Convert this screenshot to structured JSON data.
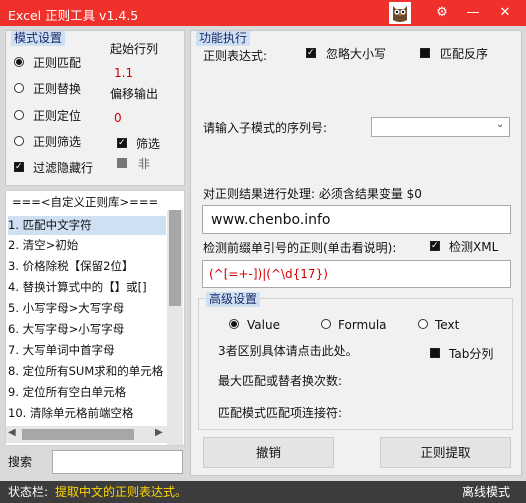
{
  "window": {
    "title": "Excel 正则工具 v1.4.5"
  },
  "mode": {
    "title": "模式设置",
    "options": [
      "正则匹配",
      "正则替换",
      "正则定位",
      "正则筛选"
    ],
    "filter_hidden": "过滤隐藏行",
    "start_row_label": "起始行列",
    "start_row_value": "1.1",
    "offset_label": "偏移输出",
    "offset_value": "0",
    "filter_label": "筛选",
    "not_label": "非"
  },
  "library": {
    "title": "===<自定义正则库>===",
    "items": [
      "1. 匹配中文字符",
      "2. 清空>初始",
      "3. 价格除税【保留2位】",
      "4. 替换计算式中的【】或[]",
      "5. 小写字母>大写字母",
      "6. 大写字母>小写字母",
      "7. 大写单词中首字母",
      "8. 定位所有SUM求和的单元格",
      "9. 定位所有空白单元格",
      "10. 清除单元格前端空格"
    ],
    "search_label": "搜索",
    "search_value": ""
  },
  "main": {
    "title": "功能执行",
    "regex_label": "正则表达式:",
    "ignore_case": "忽略大小写",
    "match_invert": "匹配反序",
    "submatch_label": "请输入子模式的序列号:",
    "process_label": "对正则结果进行处理: 必须含结果变量 $0",
    "process_value": "www.chenbo.info",
    "prefix_label": "检测前缀单引号的正则(单击看说明):",
    "detect_xml": "检测XML",
    "prefix_value": "(^[=+-])|(^\\d{17})"
  },
  "advanced": {
    "title": "高级设置",
    "options": [
      "Value",
      "Formula",
      "Text"
    ],
    "range_hint": "3者区别具体请点击此处。",
    "tab_split": "Tab分列",
    "max_match_label": "最大匹配或替者换次数:",
    "join_label": "匹配模式匹配项连接符:"
  },
  "buttons": {
    "undo": "撤销",
    "extract": "正则提取"
  },
  "status": {
    "label": "状态栏:",
    "message": "提取中文的正则表达式。",
    "mode": "离线模式"
  },
  "colors": {
    "titlebar": "#f0302b",
    "status_text": "#ffd700"
  }
}
